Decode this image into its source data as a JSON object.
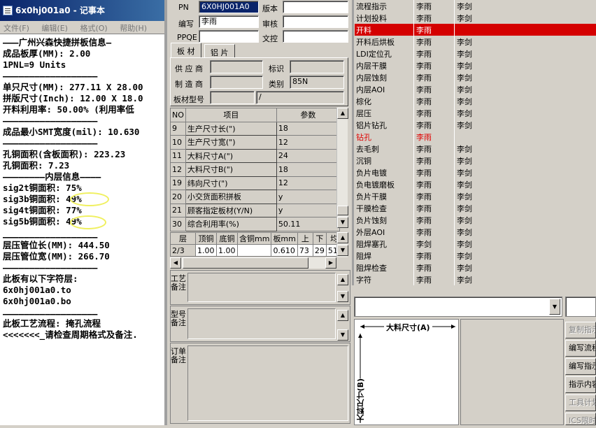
{
  "notepad": {
    "title": "6x0hj001a0 - 记事本",
    "menu": [
      "文件(F)",
      "编辑(E)",
      "格式(O)",
      "帮助(H)"
    ],
    "lines": [
      "———广州兴森快捷拼板信息—",
      "成品板厚(MM): 2.00",
      "1PNL=9 Units",
      "——————————————————",
      "单只尺寸(MM): 277.11 X 28.00",
      "拼版尺寸(Inch): 12.00 X 18.0",
      "开料利用率: 50.00% (利用率低",
      "——————————————————",
      "成品最小SMT宽度(mil): 10.630",
      "——————————————————",
      "孔铜面积(含板面积): 223.23",
      "孔铜面积: 7.23",
      "————————内层信息————",
      "sig2t铜面积: 75%",
      "sig3b铜面积: 49%",
      "sig4t铜面积: 77%",
      "sig5b铜面积: 49%",
      "——————————————————",
      "层压管位长(MM): 444.50",
      "层压管位宽(MM): 266.70",
      "——————————————————",
      "此板有以下字符层:",
      "6x0hj001a0.to",
      "6x0hj001a0.bo",
      "——————————————————",
      "此板工艺流程: 掩孔流程",
      "<<<<<<<_请检查周期格式及备注."
    ]
  },
  "form": {
    "pn_label": "PN",
    "pn_value": "6X0HJ001A0",
    "version_label": "版本",
    "author_label": "编写",
    "author_value": "李雨",
    "review_label": "审核",
    "ppqe_label": "PPQE",
    "doc_control_label": "文控",
    "tabs": [
      "板 材",
      "铝 片"
    ],
    "supplier_label": "供 应 商",
    "mark_label": "标识",
    "manufacturer_label": "制 造 商",
    "category_label": "类别",
    "category_value": "85N",
    "material_model_label": "板材型号",
    "material_model_value": "/",
    "param_headers": [
      "NO",
      "项目",
      "参数"
    ],
    "param_rows": [
      {
        "no": "9",
        "name": "生产尺寸长(\")",
        "value": "18"
      },
      {
        "no": "10",
        "name": "生产尺寸宽(\")",
        "value": "12"
      },
      {
        "no": "11",
        "name": "大料尺寸A(\")",
        "value": "24"
      },
      {
        "no": "12",
        "name": "大料尺寸B(\")",
        "value": "18"
      },
      {
        "no": "19",
        "name": "纬向尺寸(\")",
        "value": "12"
      },
      {
        "no": "20",
        "name": "小交货面积拼板",
        "value": "y"
      },
      {
        "no": "21",
        "name": "顾客指定板材(Y/N)",
        "value": "y"
      },
      {
        "no": "30",
        "name": "综合利用率(%)",
        "value": "50.11"
      }
    ],
    "layer_headers": [
      "层",
      "顶铜",
      "底铜",
      "含铜mm",
      "板mm",
      "上",
      "下",
      "均"
    ],
    "layer_rows": [
      [
        "2/3",
        "1.00",
        "1.00",
        "",
        "0.610",
        "73",
        "29",
        "51."
      ]
    ],
    "note1_label": "工艺备注",
    "note2_label": "型号备注",
    "note3_label": "订单备注"
  },
  "process": {
    "rows": [
      {
        "name": "流程指示",
        "a": "李雨",
        "b": "李剑"
      },
      {
        "name": "计划投料",
        "a": "李雨",
        "b": "李剑"
      },
      {
        "name": "开料",
        "a": "李雨",
        "b": ""
      },
      {
        "name": "开料后烘板",
        "a": "李雨",
        "b": "李剑"
      },
      {
        "name": "LDI定位孔",
        "a": "李雨",
        "b": "李剑"
      },
      {
        "name": "内层干膜",
        "a": "李雨",
        "b": "李剑"
      },
      {
        "name": "内层蚀刻",
        "a": "李雨",
        "b": "李剑"
      },
      {
        "name": "内层AOI",
        "a": "李雨",
        "b": "李剑"
      },
      {
        "name": "棕化",
        "a": "李雨",
        "b": "李剑"
      },
      {
        "name": "层压",
        "a": "李雨",
        "b": "李剑"
      },
      {
        "name": "铝片钻孔",
        "a": "李雨",
        "b": "李剑"
      },
      {
        "name": "钻孔",
        "a": "李雨",
        "b": ""
      },
      {
        "name": "去毛刺",
        "a": "李雨",
        "b": "李剑"
      },
      {
        "name": "沉铜",
        "a": "李雨",
        "b": "李剑"
      },
      {
        "name": "负片电镀",
        "a": "李雨",
        "b": "李剑"
      },
      {
        "name": "负电镀磨板",
        "a": "李雨",
        "b": "李剑"
      },
      {
        "name": "负片干膜",
        "a": "李雨",
        "b": "李剑"
      },
      {
        "name": "干膜检查",
        "a": "李雨",
        "b": "李剑"
      },
      {
        "name": "负片蚀刻",
        "a": "李雨",
        "b": "李剑"
      },
      {
        "name": "外层AOI",
        "a": "李雨",
        "b": "李剑"
      },
      {
        "name": "阻焊塞孔",
        "a": "李剑",
        "b": "李剑"
      },
      {
        "name": "阻焊",
        "a": "李雨",
        "b": "李剑"
      },
      {
        "name": "阻焊检查",
        "a": "李雨",
        "b": "李剑"
      },
      {
        "name": "字符",
        "a": "李雨",
        "b": "李剑"
      }
    ],
    "selected_index": 2,
    "red_index": 11,
    "selected_color": "#d40000",
    "red_text_color": "#e00000"
  },
  "bottom": {
    "dim_a_label": "大料尺寸(A)",
    "dim_b_label": "大料尺寸(B)",
    "side_buttons": [
      "复制指示",
      "编写流程",
      "编写指示",
      "指示内容",
      "工具计划",
      "ICS限时"
    ]
  }
}
